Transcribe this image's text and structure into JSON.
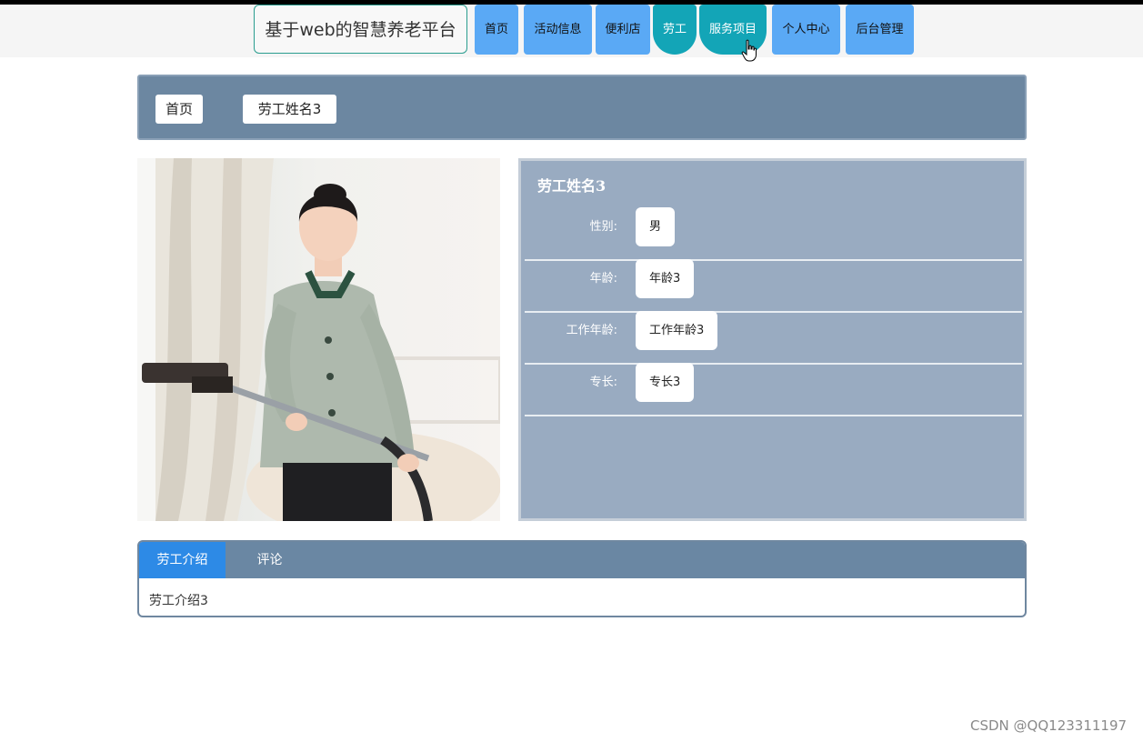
{
  "site": {
    "title": "基于web的智慧养老平台"
  },
  "nav": {
    "items": [
      {
        "label": "首页"
      },
      {
        "label": "活动信息"
      },
      {
        "label": "便利店"
      },
      {
        "label": "劳工"
      },
      {
        "label": "服务项目"
      },
      {
        "label": "个人中心"
      },
      {
        "label": "后台管理"
      }
    ]
  },
  "breadcrumb": {
    "home": "首页",
    "current": "劳工姓名3"
  },
  "worker": {
    "name": "劳工姓名3",
    "fields": [
      {
        "label": "性别:",
        "value": "男"
      },
      {
        "label": "年龄:",
        "value": "年龄3"
      },
      {
        "label": "工作年龄:",
        "value": "工作年龄3"
      },
      {
        "label": "专长:",
        "value": "专长3"
      }
    ]
  },
  "tabs": {
    "items": [
      {
        "label": "劳工介绍"
      },
      {
        "label": "评论"
      }
    ],
    "content": "劳工介绍3"
  },
  "watermark": "CSDN @QQ123311197",
  "colors": {
    "nav_blue": "#5aa9f5",
    "nav_active_teal": "#13a5b7",
    "panel_slate": "#6c87a1",
    "info_panel": "#99abc1",
    "tab_active": "#2d8ae6"
  }
}
